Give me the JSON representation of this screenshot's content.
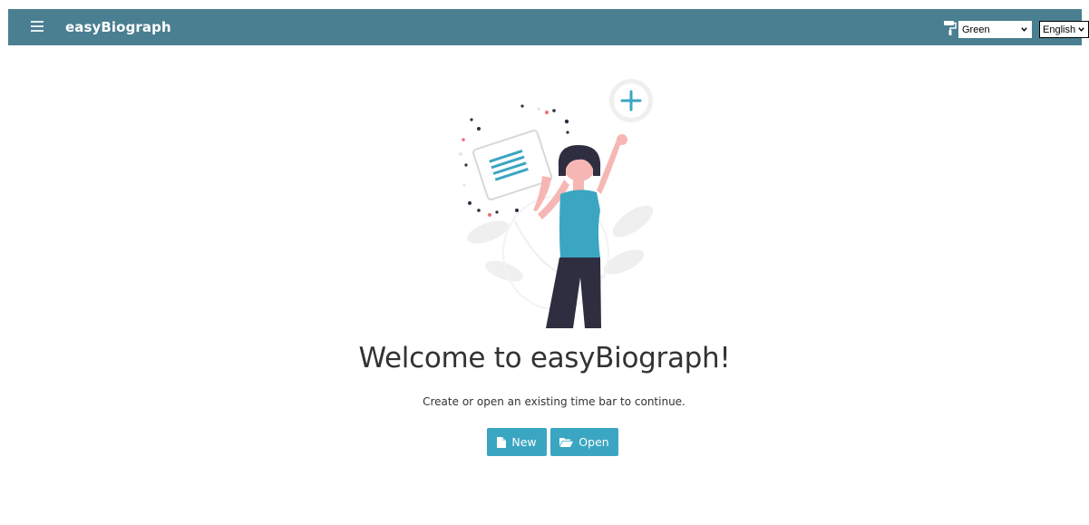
{
  "header": {
    "brand": "easyBiograph",
    "theme_select": {
      "selected": "Green"
    },
    "language_select": {
      "selected": "English"
    }
  },
  "main": {
    "title": "Welcome to easyBiograph!",
    "subtitle": "Create or open an existing time bar to continue.",
    "new_label": "New",
    "open_label": "Open"
  },
  "icons": {
    "menu": "hamburger-icon",
    "theme": "paint-roller-icon",
    "new": "file-icon",
    "open": "folder-open-icon"
  },
  "colors": {
    "navbar": "#4a7f91",
    "accent": "#3ba6c1",
    "text": "#333333"
  }
}
